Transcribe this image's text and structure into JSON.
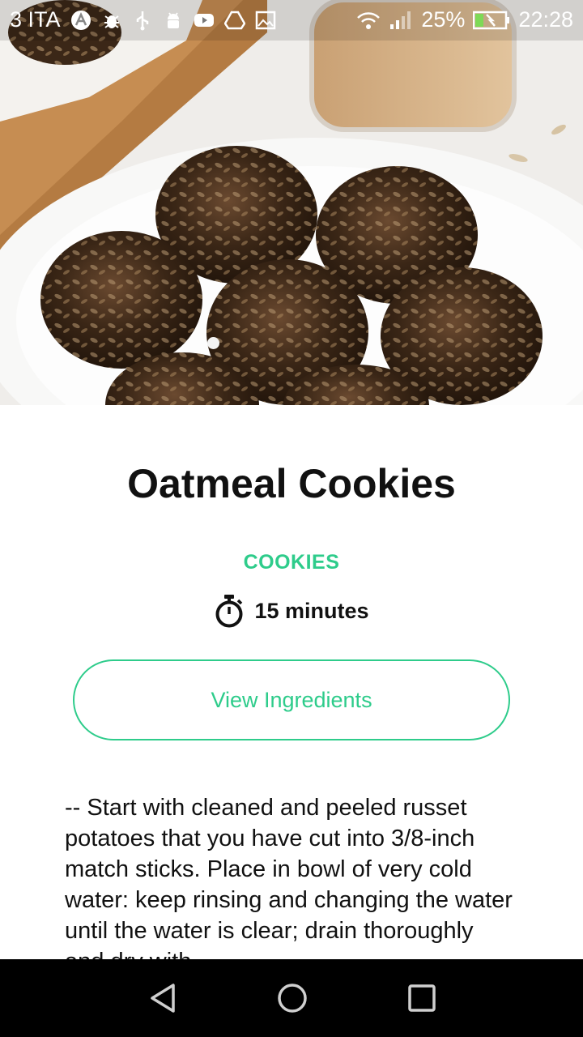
{
  "status_bar": {
    "carrier": "3 ITA",
    "battery": "25%",
    "time": "22:28",
    "icons": [
      "app-a-icon",
      "bug-icon",
      "usb-icon",
      "android-icon",
      "youtube-icon",
      "drive-icon",
      "image-icon",
      "wifi-icon",
      "signal-icon",
      "battery-charging-icon"
    ]
  },
  "hero": {
    "image": "oatmeal-cookies-photo",
    "pages_current": 1
  },
  "recipe": {
    "title": "Oatmeal Cookies",
    "category": "COOKIES",
    "time": "15 minutes",
    "time_icon": "stopwatch-icon",
    "ingredients_button": "View Ingredients",
    "description": "-- Start with cleaned and peeled russet potatoes that you have cut into 3/8-inch match sticks. Place in bowl of very cold water: keep rinsing and changing the water until the water is clear; drain thoroughly and dry with"
  },
  "nav_bar": {
    "back_icon": "back-triangle-icon",
    "home_icon": "home-circle-icon",
    "recents_icon": "recents-square-icon"
  },
  "colors": {
    "accent": "#2ecc8b",
    "text": "#111111",
    "navbar": "#000000"
  }
}
